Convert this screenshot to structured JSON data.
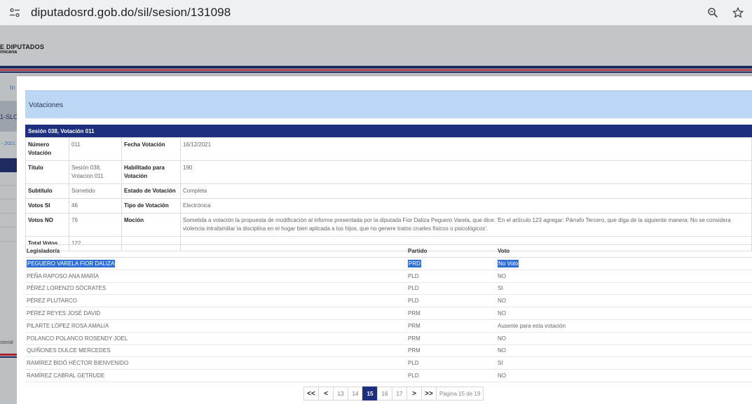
{
  "browser": {
    "url": "diputadosrd.gob.do/sil/sesion/131098",
    "icons": [
      "site-settings-icon",
      "zoom-icon",
      "bookmark-star-icon"
    ]
  },
  "background": {
    "logo_line1": "E DIPUTADOS",
    "logo_line2": "inicana",
    "nav_fragment": "In",
    "session_fragment": "1-SLO",
    "date_fragment": "- 2021 -",
    "history_fragment": "storial"
  },
  "modal": {
    "title": "Votaciones",
    "session_header": "Sesión 038, Votación 011",
    "info": {
      "numero_label": "Número Votación",
      "numero_value": "011",
      "fecha_label": "Fecha Votación",
      "fecha_value": "16/12/2021",
      "titulo_label": "Título",
      "titulo_value": "Sesión 038, Votacion 011",
      "habilitado_label": "Habilitado para Votación",
      "habilitado_value": "190",
      "subtitulo_label": "Subtítulo",
      "subtitulo_value": "Sometido",
      "estado_label": "Estado de Votación",
      "estado_value": "Completa",
      "votos_si_label": "Votos SI",
      "votos_si_value": "46",
      "tipo_label": "Tipo de Votación",
      "tipo_value": "Electrónica",
      "votos_no_label": "Votos NO",
      "votos_no_value": "76",
      "mocion_label": "Moción",
      "mocion_value": "Sometida a votación la propuesta de modificación al informe presentada por la diputada Fior Daliza Peguero Varela, que dice: 'En el artículo 123 agregar: Párrafo Tercero, que diga de la siguiente manera: No se considera violencia intrafamiliar la disciplina en el hogar bien aplicada a los hijos, que no genere tratos crueles físicos o psicológicos'.",
      "total_label": "Total Votos",
      "total_value": "122"
    },
    "votes_table": {
      "headers": [
        "Legislador/a",
        "Partido",
        "Voto"
      ],
      "rows": [
        {
          "name": "PEGUERO VARELA FIOR DALIZA",
          "party": "PRD",
          "vote": "No Voto"
        },
        {
          "name": "PEÑA RAPOSO ANA MARÍA",
          "party": "PLD",
          "vote": "NO"
        },
        {
          "name": "PÉREZ LORENZO SÓCRATES",
          "party": "PLD",
          "vote": "SI"
        },
        {
          "name": "PÉREZ PLUTARCO",
          "party": "PLD",
          "vote": "NO"
        },
        {
          "name": "PÉREZ REYES JOSÉ DAVID",
          "party": "PRM",
          "vote": "NO"
        },
        {
          "name": "PILARTE LÓPEZ ROSA AMALIA",
          "party": "PRM",
          "vote": "Ausente para esta votación"
        },
        {
          "name": "POLANCO POLANCO ROSENDY JOEL",
          "party": "PRM",
          "vote": "NO"
        },
        {
          "name": "QUIÑONES DULCE MERCEDES",
          "party": "PRM",
          "vote": "NO"
        },
        {
          "name": "RAMÍREZ BIDÓ HÉCTOR BIENVENIDO",
          "party": "PLD",
          "vote": "SI"
        },
        {
          "name": "RAMÍREZ CABRAL GETRUDE",
          "party": "PLD",
          "vote": "NO"
        }
      ]
    },
    "pager": {
      "first": "<<",
      "prev": "<",
      "pages": [
        "13",
        "14",
        "15",
        "16",
        "17"
      ],
      "current": "15",
      "next": ">",
      "last": ">>",
      "info": "Página 15 de 19"
    }
  },
  "colors": {
    "navy": "#1f2f80",
    "panel_blue": "#bcd6f5",
    "link_blue": "#3b7fd0",
    "selection": "#2f6fd3",
    "stripe_red": "#a8232f"
  }
}
